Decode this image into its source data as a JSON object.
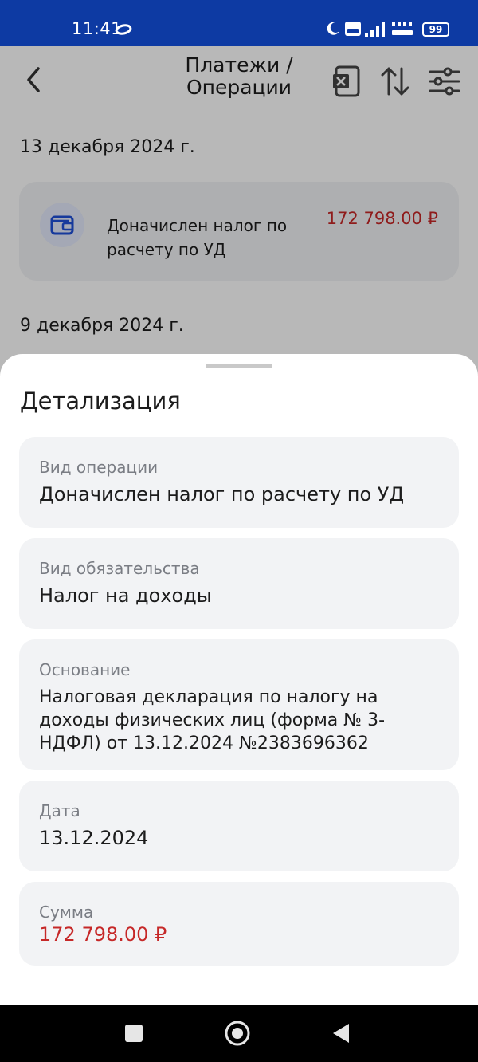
{
  "status_bar": {
    "time": "11:41",
    "battery": "99",
    "colors": {
      "background": "#0d3aa3"
    }
  },
  "header": {
    "title": "Платежи / Операции"
  },
  "operations": {
    "groups": [
      {
        "date": "13 декабря 2024 г.",
        "items": [
          {
            "description": "Доначислен налог по расчету по УД",
            "amount": "172 798.00 ₽"
          }
        ]
      },
      {
        "date": "9 декабря 2024 г.",
        "items": []
      }
    ]
  },
  "sheet": {
    "title": "Детализация",
    "fields": [
      {
        "label": "Вид операции",
        "value": "Доначислен налог по расчету по УД"
      },
      {
        "label": "Вид обязательства",
        "value": "Налог на доходы"
      },
      {
        "label": "Основание",
        "value": "Налоговая декларация по налогу на доходы физических лиц (форма № 3-НДФЛ) от 13.12.2024 №2383696362"
      },
      {
        "label": "Дата",
        "value": "13.12.2024"
      },
      {
        "label": "Сумма",
        "value": "172 798.00 ₽"
      }
    ]
  },
  "icons": {
    "back": "chevron-left-icon",
    "export": "excel-icon",
    "sort": "sort-icon",
    "filter": "sliders-icon",
    "wallet": "wallet-icon"
  },
  "colors": {
    "accent": "#1f4fd8",
    "amount_red": "#c62828",
    "card_bg": "#f2f3f5",
    "label_gray": "#7a7d84"
  }
}
